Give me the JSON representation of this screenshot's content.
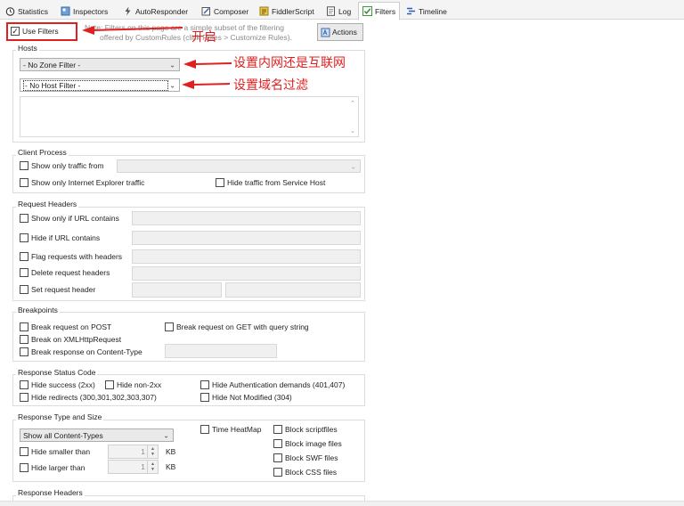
{
  "tabs": [
    {
      "label": "Statistics",
      "icon": "stopwatch-icon"
    },
    {
      "label": "Inspectors",
      "icon": "inspect-icon"
    },
    {
      "label": "AutoResponder",
      "icon": "lightning-icon"
    },
    {
      "label": "Composer",
      "icon": "compose-icon"
    },
    {
      "label": "FiddlerScript",
      "icon": "script-icon"
    },
    {
      "label": "Log",
      "icon": "log-icon"
    },
    {
      "label": "Filters",
      "icon": "checkbox-checked-icon"
    },
    {
      "label": "Timeline",
      "icon": "timeline-icon"
    }
  ],
  "top": {
    "use_filters": "Use Filters",
    "use_filters_checked": true,
    "note_line1": "Note: Filters on this page are a simple subset of the filtering",
    "note_line2": "offered by CustomRules (click Rules > Customize Rules).",
    "actions": "Actions"
  },
  "hosts": {
    "title": "Hosts",
    "zone_filter": "- No Zone Filter -",
    "host_filter": "- No Host Filter -"
  },
  "client": {
    "title": "Client Process",
    "show_only_from": "Show only traffic from",
    "show_only_ie": "Show only Internet Explorer traffic",
    "hide_service_host": "Hide traffic from Service Host"
  },
  "request_headers": {
    "title": "Request Headers",
    "show_if_url": "Show only if URL contains",
    "hide_if_url": "Hide if URL contains",
    "flag_headers": "Flag requests with headers",
    "delete_headers": "Delete request headers",
    "set_header": "Set request header"
  },
  "breakpoints": {
    "title": "Breakpoints",
    "on_post": "Break request on POST",
    "on_get_query": "Break request on GET with query string",
    "on_xhr": "Break on XMLHttpRequest",
    "on_content_type": "Break response on Content-Type"
  },
  "status": {
    "title": "Response Status Code",
    "hide_success": "Hide success (2xx)",
    "hide_non2xx": "Hide non-2xx",
    "hide_auth": "Hide Authentication demands (401,407)",
    "hide_redirects": "Hide redirects (300,301,302,303,307)",
    "hide_not_modified": "Hide Not Modified (304)"
  },
  "type_size": {
    "title": "Response Type and Size",
    "content_types": "Show all Content-Types",
    "time_heatmap": "Time HeatMap",
    "block_script": "Block scriptfiles",
    "block_image": "Block image files",
    "block_swf": "Block SWF files",
    "block_css": "Block CSS files",
    "hide_smaller": "Hide smaller than",
    "hide_larger": "Hide larger than",
    "smaller_value": "1",
    "larger_value": "1",
    "unit": "KB"
  },
  "response_headers": {
    "title": "Response Headers"
  },
  "annotations": {
    "enable": "开启",
    "zone": "设置内网还是互联网",
    "host": "设置域名过滤"
  },
  "colors": {
    "annotation_red": "#e02020",
    "highlight_blue": "#2b5fb8"
  }
}
